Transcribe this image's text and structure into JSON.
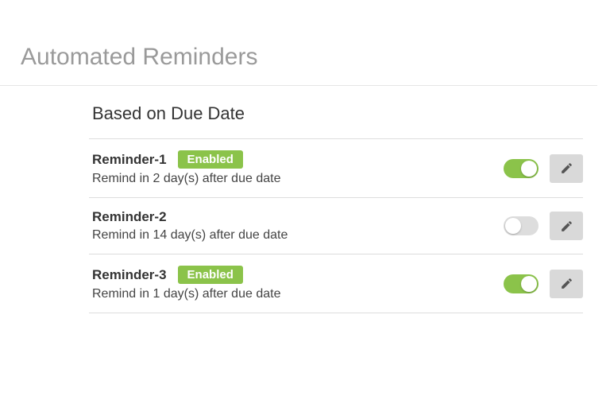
{
  "page_title": "Automated Reminders",
  "section_title": "Based on Due Date",
  "badge_label": "Enabled",
  "reminders": [
    {
      "name": "Reminder-1",
      "enabled": true,
      "description": "Remind in 2 day(s) after due date"
    },
    {
      "name": "Reminder-2",
      "enabled": false,
      "description": "Remind in 14 day(s) after due date"
    },
    {
      "name": "Reminder-3",
      "enabled": true,
      "description": "Remind in 1 day(s) after due date"
    }
  ]
}
